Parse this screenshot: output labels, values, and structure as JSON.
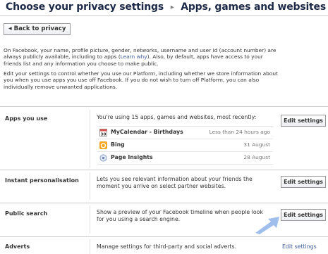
{
  "header": {
    "crumb_parent": "Choose your privacy settings",
    "crumb_separator": "▸",
    "crumb_current": "Apps, games and websites"
  },
  "back_button": {
    "label": "Back to privacy",
    "icon": "arrow-left-icon"
  },
  "intro": {
    "p1_before_link": "On Facebook, your name, profile picture, gender, networks, username and user id (account number) are always publicly available, including to apps (",
    "p1_link": "Learn why",
    "p1_after_link": "). Also, by default, apps have access to your friends list and any information you choose to make public.",
    "p2": "Edit your settings to control whether you use our Platform, including whether we store information about you when you use apps you use off Facebook. If you do not wish to turn off Platform, you can also individually remove unwanted applications."
  },
  "sections": {
    "apps": {
      "label": "Apps you use",
      "summary": "You're using 15 apps, games and websites, most recently:",
      "button": "Edit settings",
      "items": [
        {
          "name": "MyCalendar - Birthdays",
          "date": "Less than 24 hours ago",
          "icon": "calendar-icon"
        },
        {
          "name": "Bing",
          "date": "31 August",
          "icon": "bing-icon"
        },
        {
          "name": "Page Insights",
          "date": "28 August",
          "icon": "insights-icon"
        }
      ]
    },
    "instant": {
      "label": "Instant personalisation",
      "description": "Lets you see relevant information about your friends the moment you arrive on select partner websites.",
      "button": "Edit settings"
    },
    "public_search": {
      "label": "Public search",
      "description": "Show a preview of your Facebook timeline when people look for you using a search engine.",
      "button": "Edit settings"
    },
    "adverts": {
      "label": "Adverts",
      "description": "Manage settings for third-party and social adverts.",
      "link": "Edit settings"
    }
  },
  "colors": {
    "title": "#1c2a47",
    "link": "#3b5998",
    "pointer_arrow": "#8fb3e8"
  }
}
